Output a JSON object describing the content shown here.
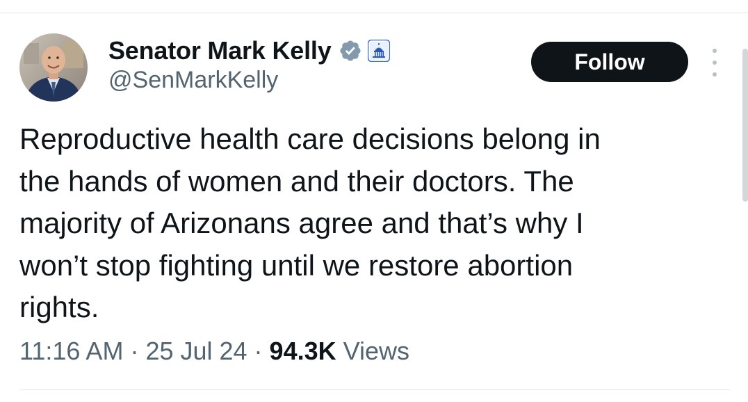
{
  "author": {
    "display_name": "Senator Mark Kelly",
    "handle": "@SenMarkKelly",
    "verified_badge_icon": "verified-badge-icon",
    "affiliation_badge_icon": "capitol-building-icon",
    "verified_color": "#829aab"
  },
  "actions": {
    "follow_label": "Follow",
    "more_icon": "more-vertical-icon"
  },
  "tweet": {
    "text": "Reproductive health care decisions belong in\nthe hands of women and their doctors. The\nmajority of Arizonans agree and that’s why I\nwon’t stop fighting until we restore abortion\nrights."
  },
  "meta": {
    "time": "11:16 AM",
    "separator": "·",
    "date": "25 Jul 24",
    "views_count": "94.3K",
    "views_label": "Views"
  }
}
